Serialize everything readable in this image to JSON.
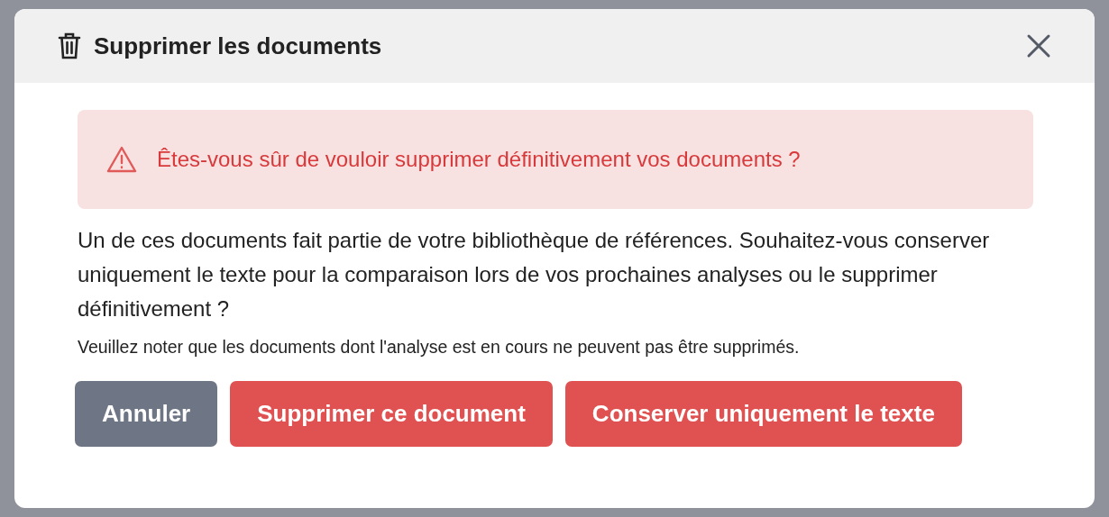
{
  "dialog": {
    "title": "Supprimer les documents",
    "alert": "Êtes-vous sûr de vouloir supprimer définitivement vos documents ?",
    "message": "Un de ces documents fait partie de votre bibliothèque de références. Souhaitez-vous conserver uniquement le texte pour la comparaison lors de vos prochaines analyses ou le supprimer définitivement ?",
    "note": "Veuillez noter que les documents dont l'analyse est en cours ne peuvent pas être supprimés.",
    "buttons": [
      {
        "label": "Annuler",
        "kind": "secondary"
      },
      {
        "label": "Supprimer ce document",
        "kind": "danger"
      },
      {
        "label": "Conserver uniquement le texte",
        "kind": "danger"
      }
    ]
  }
}
